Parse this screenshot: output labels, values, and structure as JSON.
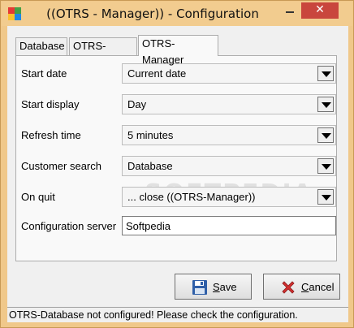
{
  "window": {
    "title": "((OTRS - Manager)) - Configuration",
    "close_label": "✕"
  },
  "tabs": [
    {
      "label": "Database",
      "active": false
    },
    {
      "label": "OTRS-Server",
      "active": false
    },
    {
      "label": "OTRS-Manager",
      "active": true
    }
  ],
  "form": {
    "start_date": {
      "label": "Start date",
      "value": "Current date"
    },
    "start_display": {
      "label": "Start display",
      "value": "Day"
    },
    "refresh_time": {
      "label": "Refresh time",
      "value": "5 minutes"
    },
    "customer_search": {
      "label": "Customer search",
      "value": "Database"
    },
    "on_quit": {
      "label": "On quit",
      "value": "... close ((OTRS-Manager))"
    },
    "configuration_server": {
      "label": "Configuration server",
      "value": "Softpedia"
    }
  },
  "buttons": {
    "save_mnemonic": "S",
    "save_rest": "ave",
    "cancel_mnemonic": "C",
    "cancel_rest": "ancel"
  },
  "status": {
    "message": "OTRS-Database not configured! Please check the configuration."
  },
  "watermark": "SOFTPEDIA",
  "colors": {
    "title_bar": "#f2cc8f",
    "close_button": "#c9463d",
    "panel": "#f9f9f9"
  }
}
